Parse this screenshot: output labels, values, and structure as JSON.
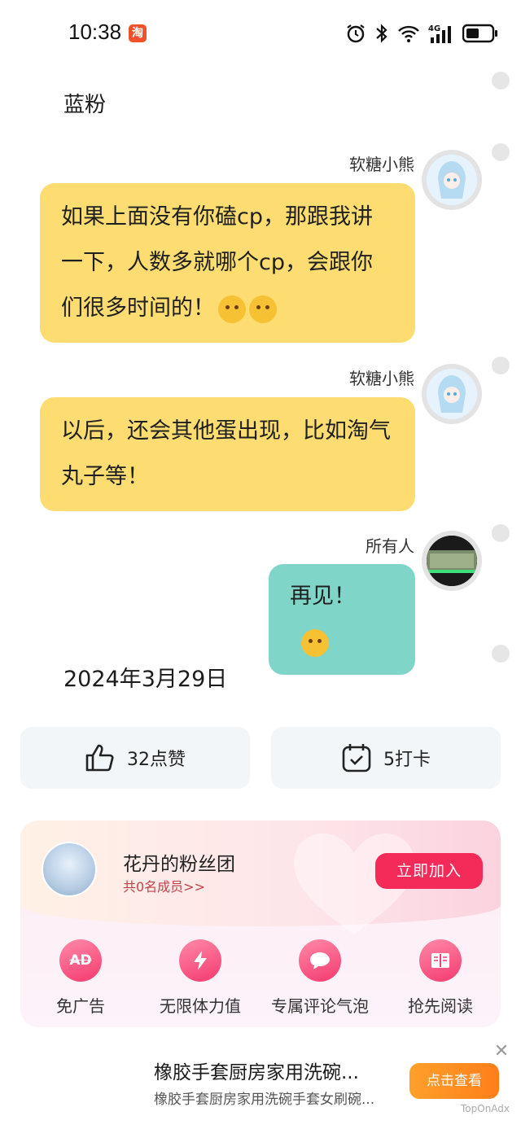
{
  "status_bar": {
    "time": "10:38",
    "notification_app": "淘",
    "network": "4G"
  },
  "feed": {
    "section_title": "蓝粉",
    "messages": [
      {
        "sender": "软糖小熊",
        "text": "如果上面没有你磕cp，那跟我讲一下，人数多就哪个cp，会跟你们很多时间的！",
        "emojis": [
          "wink-emoji",
          "wink-emoji"
        ]
      },
      {
        "sender": "软糖小熊",
        "text": "以后，还会其他蛋出现，比如淘气丸子等！",
        "emojis": []
      },
      {
        "sender": "所有人",
        "text": "再见！",
        "emojis": [
          "grin-emoji"
        ]
      }
    ],
    "date": "2024年3月29日"
  },
  "actions": {
    "like_label": "32点赞",
    "checkin_label": "5打卡"
  },
  "fan_club": {
    "name": "花丹的粉丝团",
    "members": "共0名成员>>",
    "join_label": "立即加入",
    "perks": [
      {
        "icon": "ad-free-icon",
        "badge": "AD",
        "label": "免广告"
      },
      {
        "icon": "lightning-icon",
        "badge": "",
        "label": "无限体力值"
      },
      {
        "icon": "comment-bubble-icon",
        "badge": "",
        "label": "专属评论气泡"
      },
      {
        "icon": "book-icon",
        "badge": "",
        "label": "抢先阅读"
      }
    ]
  },
  "ad": {
    "title": "橡胶手套厨房家用洗碗...",
    "subtitle": "橡胶手套厨房家用洗碗手套女刷碗...",
    "button_label": "点击查看",
    "close_glyph": "✕",
    "source": "TopOnAdx"
  },
  "colors": {
    "bubble_yellow": "#fddc72",
    "bubble_teal": "#7fd6c8",
    "accent_pink": "#f42a58",
    "ad_orange": "#ff8c22"
  }
}
